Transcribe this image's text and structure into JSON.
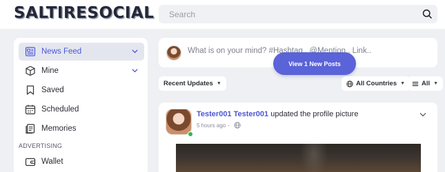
{
  "brand": {
    "logo_text": "SALTIRESOCIAL"
  },
  "search": {
    "placeholder": "Search",
    "icon": "search-icon"
  },
  "sidebar": {
    "items": [
      {
        "label": "News Feed",
        "icon": "newspaper-icon",
        "active": true,
        "has_chevron": true
      },
      {
        "label": "Mine",
        "icon": "cube-icon",
        "active": false,
        "has_chevron": true
      },
      {
        "label": "Saved",
        "icon": "bookmark-icon",
        "active": false,
        "has_chevron": false
      },
      {
        "label": "Scheduled",
        "icon": "calendar-icon",
        "active": false,
        "has_chevron": false
      },
      {
        "label": "Memories",
        "icon": "memories-icon",
        "active": false,
        "has_chevron": false
      }
    ],
    "section_advertising": "ADVERTISING",
    "advertising_items": [
      {
        "label": "Wallet",
        "icon": "wallet-icon"
      }
    ]
  },
  "composer": {
    "placeholder": "What is on your mind? #Hashtag.. @Mention.. Link.."
  },
  "new_posts_button": {
    "label": "View 1 New Posts"
  },
  "filters": {
    "sort_label": "Recent Updates",
    "countries_label": "All Countries",
    "type_label": "All"
  },
  "post": {
    "author": "Tester001 Tester001",
    "action": "updated the profile picture",
    "time": "5 hours ago",
    "separator": "-"
  },
  "colors": {
    "accent": "#5a63d8",
    "link": "#4b57d6",
    "online": "#36b34b",
    "page_bg": "#eef0f3"
  }
}
